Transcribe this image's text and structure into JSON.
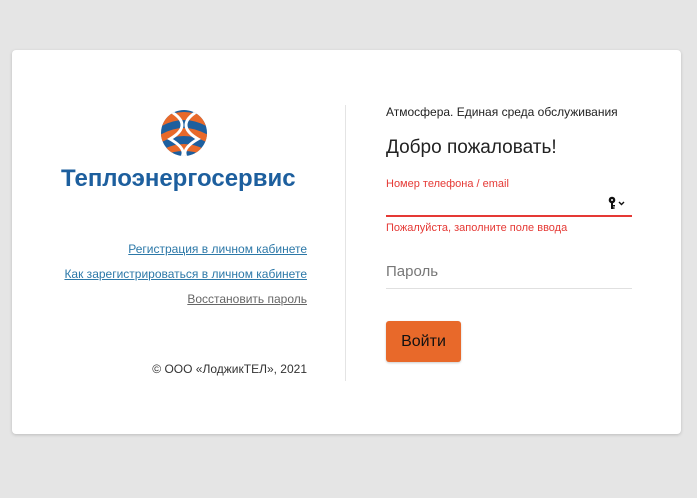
{
  "brand": {
    "name": "Теплоэнергосервис",
    "logo_icon": "sphere-logo-icon",
    "colors": {
      "blue": "#1d5f9e",
      "orange": "#e8692a"
    }
  },
  "links": {
    "register": "Регистрация в личном кабинете",
    "how_to_register": "Как зарегистрироваться в личном кабинете",
    "restore_password": "Восстановить пароль"
  },
  "copyright": "© ООО «ЛоджикТЕЛ», 2021",
  "login": {
    "subtitle": "Атмосфера. Единая среда обслуживания",
    "welcome": "Добро пожаловать!",
    "phone_label": "Номер телефона / email",
    "phone_value": "",
    "phone_icon": "key-dropdown-icon",
    "phone_error": "Пожалуйста, заполните поле ввода",
    "password_placeholder": "Пароль",
    "submit_label": "Войти"
  },
  "colors": {
    "error": "#e53935",
    "button": "#e8692a",
    "link": "#2c78a8"
  }
}
